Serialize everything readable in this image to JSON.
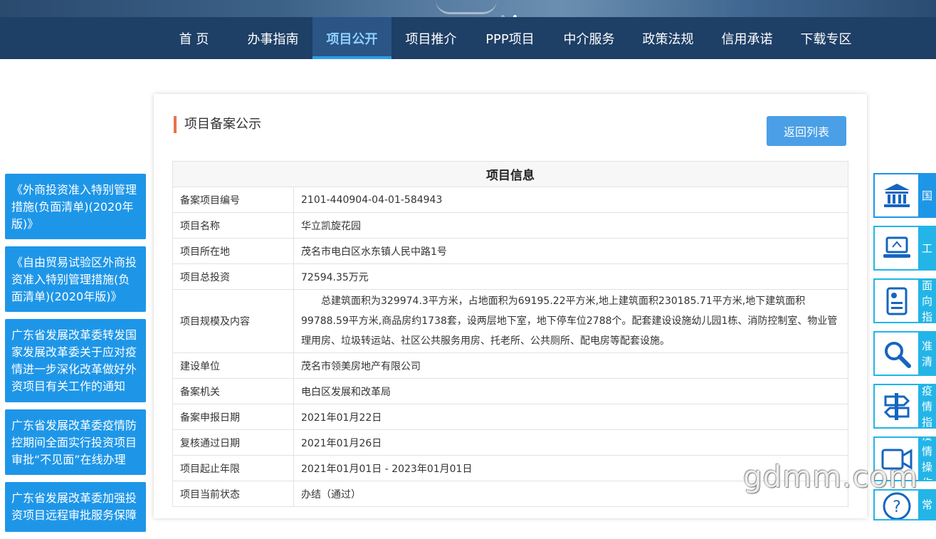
{
  "nav": {
    "items": [
      {
        "label": "首 页"
      },
      {
        "label": "办事指南"
      },
      {
        "label": "项目公开",
        "active": true
      },
      {
        "label": "项目推介"
      },
      {
        "label": "PPP项目"
      },
      {
        "label": "中介服务"
      },
      {
        "label": "政策法规"
      },
      {
        "label": "信用承诺"
      },
      {
        "label": "下载专区"
      }
    ]
  },
  "left_links": [
    "《外商投资准入特别管理措施(负面清单)(2020年版)》",
    "《自由贸易试验区外商投资准入特别管理措施(负面清单)(2020年版)》",
    "广东省发展改革委转发国家发展改革委关于应对疫情进一步深化改革做好外资项目有关工作的通知",
    "广东省发展改革委疫情防控期间全面实行投资项目审批“不见面”在线办理",
    "广东省发展改革委加强投资项目远程审批服务保障"
  ],
  "main": {
    "section_title": "项目备案公示",
    "back_button": "返回列表",
    "table_title": "项目信息",
    "rows": [
      {
        "label": "备案项目编号",
        "value": "2101-440904-04-01-584943"
      },
      {
        "label": "项目名称",
        "value": "华立凯旋花园"
      },
      {
        "label": "项目所在地",
        "value": "茂名市电白区水东镇人民中路1号"
      },
      {
        "label": "项目总投资",
        "value": "72594.35万元"
      },
      {
        "label": "项目规模及内容",
        "value": "总建筑面积为329974.3平方米，占地面积为69195.22平方米,地上建筑面积230185.71平方米,地下建筑面积99788.59平方米,商品房约1738套，设两层地下室，地下停车位2788个。配套建设设施幼儿园1栋、消防控制室、物业管理用房、垃圾转运站、社区公共服务用房、托老所、公共厕所、配电房等配套设施。"
      },
      {
        "label": "建设单位",
        "value": "茂名市领美房地产有限公司"
      },
      {
        "label": "备案机关",
        "value": "电白区发展和改革局"
      },
      {
        "label": "备案申报日期",
        "value": "2021年01月22日"
      },
      {
        "label": "复核通过日期",
        "value": "2021年01月26日"
      },
      {
        "label": "项目起止年限",
        "value": "2021年01月01日 - 2023年01月01日"
      },
      {
        "label": "项目当前状态",
        "value": "办结（通过）"
      }
    ]
  },
  "right_strip": [
    {
      "label": "国",
      "icon": "government-building-icon"
    },
    {
      "label": "工",
      "icon": "laptop-icon"
    },
    {
      "label": "面向\n指",
      "icon": "document-person-icon"
    },
    {
      "label": "准\n清",
      "icon": "search-icon"
    },
    {
      "label": "疫情\n指",
      "icon": "signpost-icon"
    },
    {
      "label": "疫情\n操作",
      "icon": "video-camera-icon"
    },
    {
      "label": "常",
      "icon": "question-icon"
    }
  ],
  "watermark": "gdmm.com",
  "colors": {
    "nav_bg": "#1e3f66",
    "link_blue": "#1e96e8",
    "accent_orange": "#e8734a",
    "strip_cyan": "#23b5e8"
  }
}
